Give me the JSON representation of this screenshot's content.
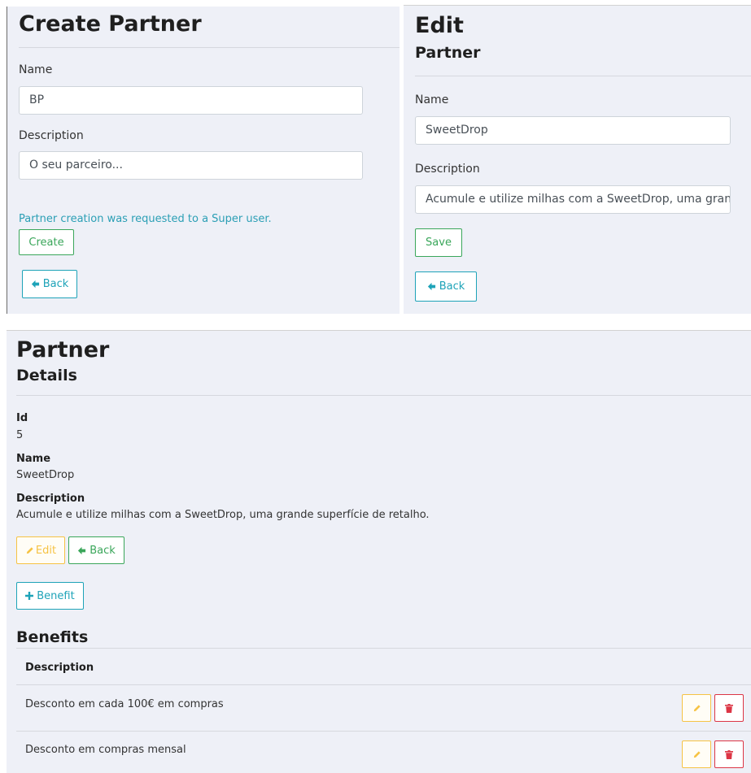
{
  "create_panel": {
    "title": "Create Partner",
    "name_label": "Name",
    "name_value": "BP",
    "description_label": "Description",
    "description_value": "O seu parceiro...",
    "notice": "Partner creation was requested to a Super user.",
    "create_button": "Create",
    "back_button": "Back"
  },
  "edit_panel": {
    "title": "Edit",
    "subtitle": "Partner",
    "name_label": "Name",
    "name_value": "SweetDrop",
    "description_label": "Description",
    "description_value": "Acumule e utilize milhas com a SweetDrop, uma grande superfície de retalho.",
    "save_button": "Save",
    "back_button": "Back"
  },
  "details_panel": {
    "title": "Partner",
    "subtitle": "Details",
    "fields": [
      {
        "label": "Id",
        "value": "5"
      },
      {
        "label": "Name",
        "value": "SweetDrop"
      },
      {
        "label": "Description",
        "value": "Acumule e utilize milhas com a SweetDrop, uma grande superfície de retalho."
      }
    ],
    "edit_button": "Edit",
    "back_button": "Back",
    "add_benefit_button": "Benefit",
    "benefits_heading": "Benefits",
    "table": {
      "columns": [
        "Description"
      ],
      "rows": [
        {
          "description": "Desconto em cada 100€ em compras"
        },
        {
          "description": "Desconto em compras mensal"
        }
      ]
    }
  },
  "icons": {
    "back": "arrow-left-icon",
    "add": "plus-icon",
    "edit": "pencil-icon",
    "delete": "trash-icon"
  },
  "colors": {
    "success": "#3aa65a",
    "info": "#1ea3b8",
    "warning": "#f6c344",
    "danger": "#dc3545",
    "panel_background": "#eef0f7"
  }
}
